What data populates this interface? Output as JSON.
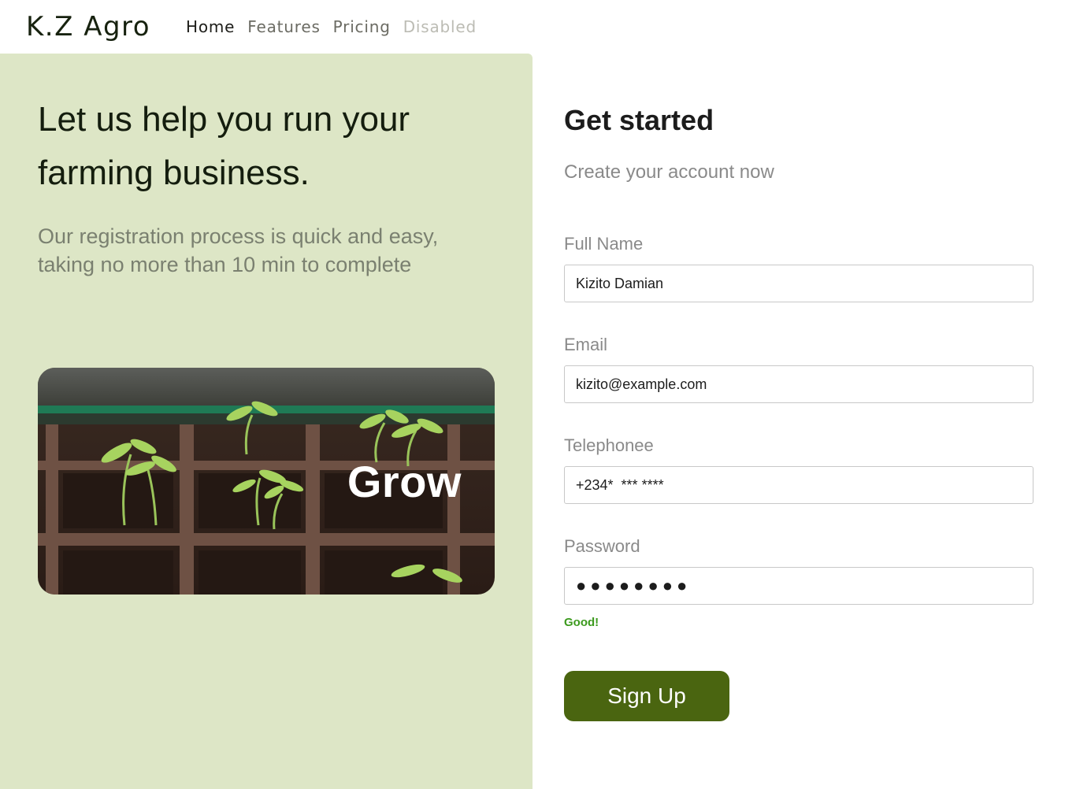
{
  "brand": "K.Z Agro",
  "nav": [
    {
      "label": "Home",
      "state": "active"
    },
    {
      "label": "Features",
      "state": "normal"
    },
    {
      "label": "Pricing",
      "state": "normal"
    },
    {
      "label": "Disabled",
      "state": "disabled"
    }
  ],
  "left": {
    "headline": "Let us help you run your farming business.",
    "subline": "Our registration process is quick and easy, taking no more than 10 min to complete",
    "hero_text": "Grow",
    "panel_color": "#dde6c6"
  },
  "form": {
    "title": "Get started",
    "subtitle": "Create your account now",
    "fields": [
      {
        "label": "Full Name",
        "value": "Kizito Damian"
      },
      {
        "label": "Email",
        "value": "kizito@example.com"
      },
      {
        "label": "Telephonee",
        "value": "+234*  *** ****"
      },
      {
        "label": "Password",
        "value": "●●●●●●●●"
      }
    ],
    "password_hint": "Good!",
    "submit_label": "Sign Up",
    "accent_color": "#4a6510",
    "hint_color": "#3c9a1e"
  }
}
